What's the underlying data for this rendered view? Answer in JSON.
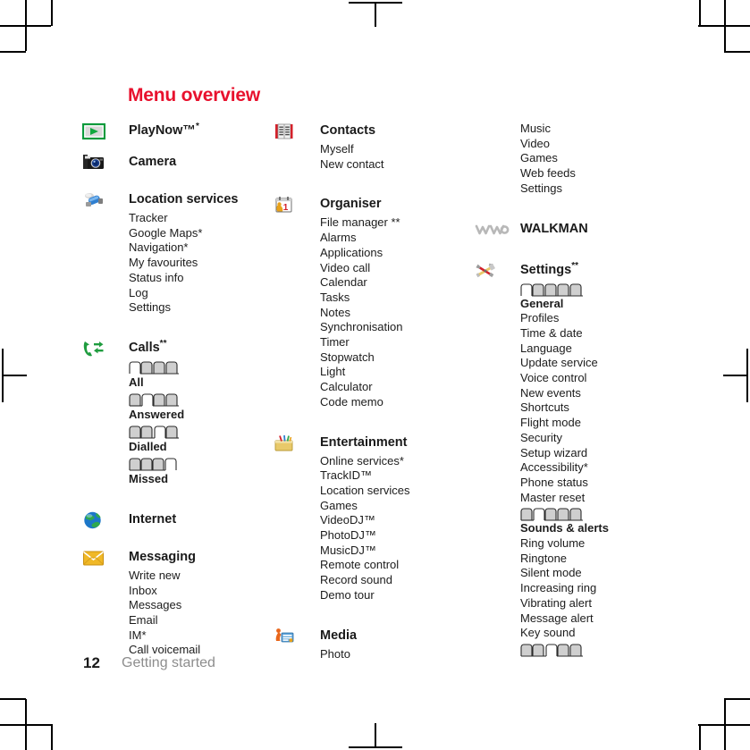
{
  "document": {
    "title": "Menu overview",
    "title_color": "#e8112d",
    "footer_page_number": "12",
    "footer_section": "Getting started"
  },
  "columns": [
    {
      "id": "column-1",
      "groups": [
        {
          "name": "playnow",
          "icon": "playnow-icon",
          "title": "PlayNow™",
          "sup": "*",
          "items": []
        },
        {
          "name": "camera",
          "icon": "camera-icon",
          "title": "Camera",
          "sup": "",
          "items": []
        },
        {
          "name": "location-services",
          "icon": "location-services-icon",
          "title": "Location services",
          "sup": "",
          "items": [
            "Tracker",
            "Google Maps*",
            "Navigation*",
            "My favourites",
            "Status info",
            "Log",
            "Settings"
          ]
        },
        {
          "name": "calls",
          "icon": "calls-icon",
          "title": "Calls",
          "sup": "**",
          "tab_groups": [
            {
              "label": "All",
              "tabs": 4,
              "selected": 0
            },
            {
              "label": "Answered",
              "tabs": 4,
              "selected": 1
            },
            {
              "label": "Dialled",
              "tabs": 4,
              "selected": 2
            },
            {
              "label": "Missed",
              "tabs": 4,
              "selected": 3
            }
          ],
          "items": []
        },
        {
          "name": "internet",
          "icon": "internet-icon",
          "title": "Internet",
          "sup": "",
          "items": []
        },
        {
          "name": "messaging",
          "icon": "messaging-icon",
          "title": "Messaging",
          "sup": "",
          "items": [
            "Write new",
            "Inbox",
            "Messages",
            "Email",
            "IM*",
            "Call voicemail"
          ]
        }
      ]
    },
    {
      "id": "column-2",
      "groups": [
        {
          "name": "contacts",
          "icon": "contacts-icon",
          "title": "Contacts",
          "sup": "",
          "items": [
            "Myself",
            "New contact"
          ]
        },
        {
          "name": "organiser",
          "icon": "organiser-icon",
          "title": "Organiser",
          "sup": "",
          "items": [
            "File manager **",
            "Alarms",
            "Applications",
            "Video call",
            "Calendar",
            "Tasks",
            "Notes",
            "Synchronisation",
            "Timer",
            "Stopwatch",
            "Light",
            "Calculator",
            "Code memo"
          ]
        },
        {
          "name": "entertainment",
          "icon": "entertainment-icon",
          "title": "Entertainment",
          "sup": "",
          "items": [
            "Online services*",
            "TrackID™",
            "Location services",
            "Games",
            "VideoDJ™",
            "PhotoDJ™",
            "MusicDJ™",
            "Remote control",
            "Record sound",
            "Demo tour"
          ]
        },
        {
          "name": "media",
          "icon": "media-icon",
          "title": "Media",
          "sup": "",
          "items": [
            "Photo"
          ]
        }
      ]
    },
    {
      "id": "column-3",
      "groups": [
        {
          "name": "media-continued",
          "icon": "",
          "title": "",
          "sup": "",
          "items": [
            "Music",
            "Video",
            "Games",
            "Web feeds",
            "Settings"
          ]
        },
        {
          "name": "walkman",
          "icon": "walkman-icon",
          "title": "WALKMAN",
          "sup": "",
          "items": []
        },
        {
          "name": "settings",
          "icon": "settings-icon",
          "title": "Settings",
          "sup": "**",
          "tab_sections": [
            {
              "tabs": 5,
              "selected": 0,
              "heading": "General",
              "items": [
                "Profiles",
                "Time & date",
                "Language",
                "Update service",
                "Voice control",
                "New events",
                "Shortcuts",
                "Flight mode",
                "Security",
                "Setup wizard",
                "Accessibility*",
                "Phone status",
                "Master reset"
              ]
            },
            {
              "tabs": 5,
              "selected": 1,
              "heading": "Sounds & alerts",
              "items": [
                "Ring volume",
                "Ringtone",
                "Silent mode",
                "Increasing ring",
                "Vibrating alert",
                "Message alert",
                "Key sound"
              ]
            },
            {
              "tabs": 5,
              "selected": 2,
              "heading": "",
              "items": []
            }
          ],
          "items": []
        }
      ]
    }
  ]
}
